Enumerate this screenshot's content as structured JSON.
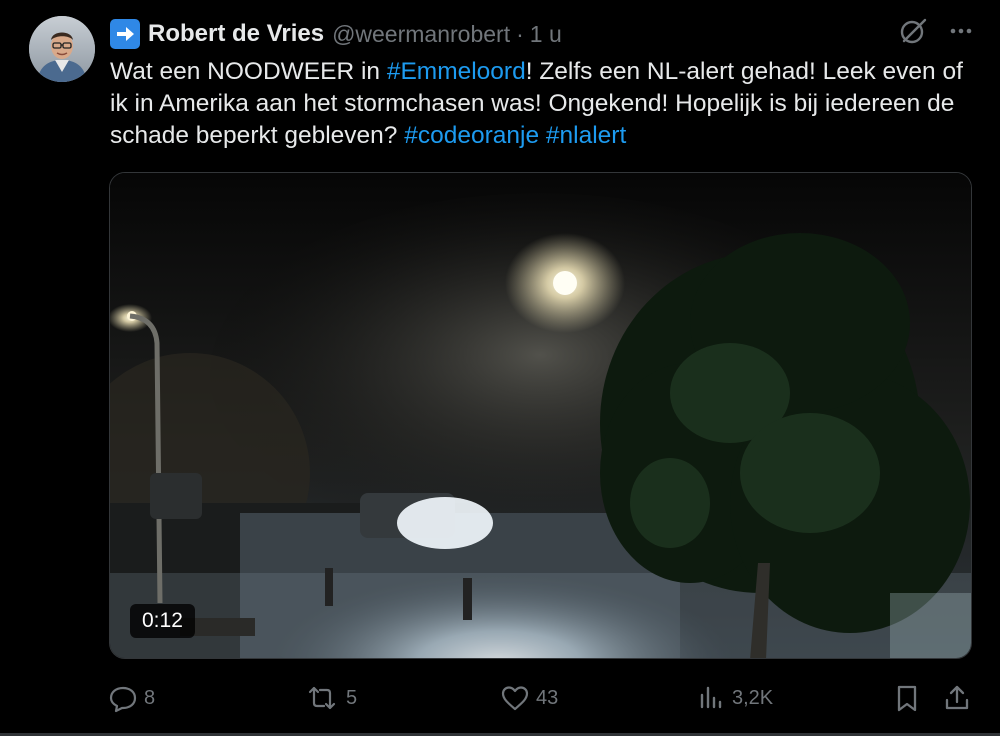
{
  "author": {
    "name": "Robert de Vries",
    "handle": "@weermanrobert",
    "time": "1 u",
    "badge_icon": "right-arrow-emoji"
  },
  "tweet": {
    "segments": [
      {
        "text": "Wat een NOODWEER in ",
        "type": "text"
      },
      {
        "text": "#Emmeloord",
        "type": "hashtag"
      },
      {
        "text": "! Zelfs een NL-alert gehad! Leek even of ik in Amerika aan het stormchasen was! Ongekend! Hopelijk is bij iedereen de schade beperkt gebleven? ",
        "type": "text"
      },
      {
        "text": "#codeoranje",
        "type": "hashtag"
      },
      {
        "text": " ",
        "type": "text"
      },
      {
        "text": "#nlalert",
        "type": "hashtag"
      }
    ]
  },
  "video": {
    "duration": "0:12"
  },
  "actions": {
    "replies": "8",
    "reposts": "5",
    "likes": "43",
    "views": "3,2K"
  },
  "colors": {
    "background": "#000000",
    "text": "#e7e9ea",
    "muted": "#71767b",
    "link": "#1d9bf0",
    "badge": "#2f88e6"
  }
}
